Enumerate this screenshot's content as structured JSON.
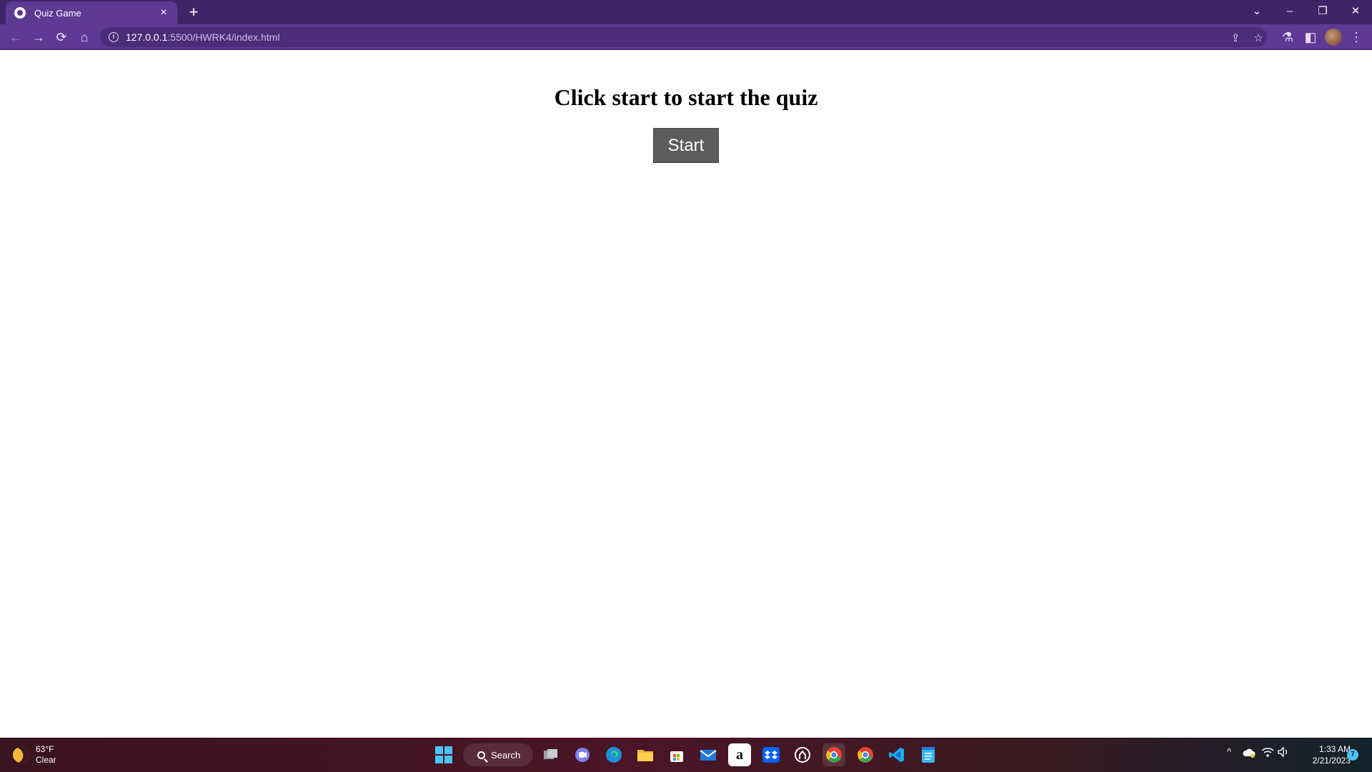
{
  "browser": {
    "tab": {
      "title": "Quiz Game",
      "close_glyph": "×"
    },
    "new_tab_glyph": "+",
    "window_controls": {
      "tabsearch": "⌄",
      "minimize": "–",
      "restore": "❐",
      "close": "✕"
    },
    "nav": {
      "back": "←",
      "forward": "→",
      "reload": "⟳",
      "home": "⌂"
    },
    "address": {
      "host": "127.0.0.1",
      "path": ":5500/HWRK4/index.html",
      "info_glyph": "i"
    },
    "right_icons": {
      "share": "⇪",
      "star": "☆",
      "labs": "⚗",
      "sidepanel": "◧",
      "menu": "⋮"
    },
    "colors": {
      "frame": "#3f2567",
      "toolbar": "#5e3a94"
    }
  },
  "page": {
    "heading": "Click start to start the quiz",
    "start_button": "Start",
    "colors": {
      "button_bg": "#5c5c5c"
    }
  },
  "taskbar": {
    "weather": {
      "temperature": "63°F",
      "condition": "Clear"
    },
    "search_label": "Search",
    "apps": [
      {
        "name": "start-icon"
      },
      {
        "name": "task-view-icon"
      },
      {
        "name": "teams-chat-icon"
      },
      {
        "name": "edge-icon"
      },
      {
        "name": "file-explorer-icon"
      },
      {
        "name": "microsoft-store-icon"
      },
      {
        "name": "mail-icon"
      },
      {
        "name": "amazon-icon",
        "glyph": "a"
      },
      {
        "name": "dropbox-icon"
      },
      {
        "name": "github-desktop-icon"
      },
      {
        "name": "chrome-profile-icon"
      },
      {
        "name": "chrome-icon"
      },
      {
        "name": "vscode-icon"
      },
      {
        "name": "notepad-icon"
      }
    ],
    "tray": {
      "chevron": "^",
      "time": "1:33 AM",
      "date": "2/21/2023",
      "notifications": "7"
    }
  }
}
